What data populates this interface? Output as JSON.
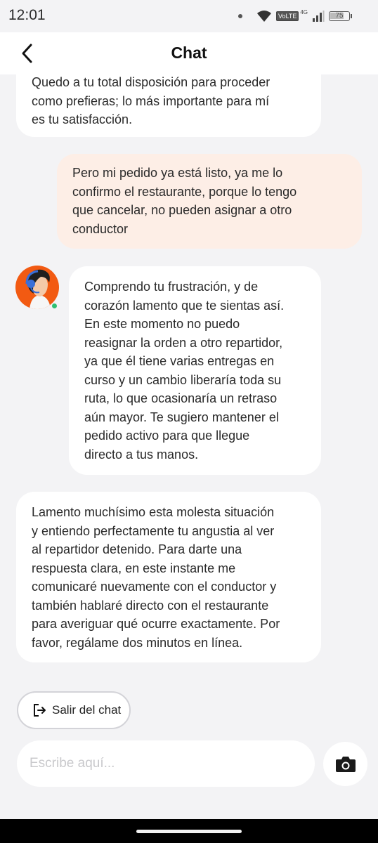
{
  "status_bar": {
    "time": "12:01",
    "network_label": "VoLTE",
    "network_type": "4G",
    "battery": "75",
    "battery_level": 0.75
  },
  "header": {
    "title": "Chat"
  },
  "messages": [
    {
      "sender": "agent",
      "text": "Quedo a tu total disposición para proceder\ncomo prefieras; lo más importante para mí\nes tu satisfacción."
    },
    {
      "sender": "user",
      "text": "Pero mi pedido ya está listo, ya me lo\nconfirmo el restaurante, porque lo tengo\nque cancelar, no pueden asignar a otro\nconductor"
    },
    {
      "sender": "agent",
      "text": "Comprendo tu frustración, y de\ncorazón lamento que te sientas así.\nEn este momento no puedo\nreasignar la orden a otro repartidor,\nya que él tiene varias entregas en\ncurso y un cambio liberaría toda su\nruta, lo que ocasionaría un retraso\naún mayor. Te sugiero mantener el\npedido activo para que llegue\ndirecto a tus manos."
    },
    {
      "sender": "agent",
      "text": "Lamento muchísimo esta molesta situación\ny entiendo perfectamente tu angustia al ver\nal repartidor detenido. Para darte una\nrespuesta clara, en este instante me\ncomunicaré nuevamente con el conductor y\ntambién hablaré directo con el restaurante\npara averiguar qué ocurre exactamente. Por\nfavor, regálame dos minutos en línea."
    }
  ],
  "actions": {
    "exit_label": "Salir del chat"
  },
  "composer": {
    "placeholder": "Escribe aquí...",
    "value": ""
  },
  "colors": {
    "background": "#f3f3f5",
    "user_bubble": "#fdeee6",
    "agent_bubble": "#ffffff",
    "avatar_bg": "#f25a12",
    "online": "#2fbf71"
  },
  "icons": {
    "back": "chevron-left-icon",
    "exit": "logout-icon",
    "camera": "camera-icon",
    "wifi": "wifi-icon",
    "signal": "signal-icon",
    "battery": "battery-icon"
  }
}
